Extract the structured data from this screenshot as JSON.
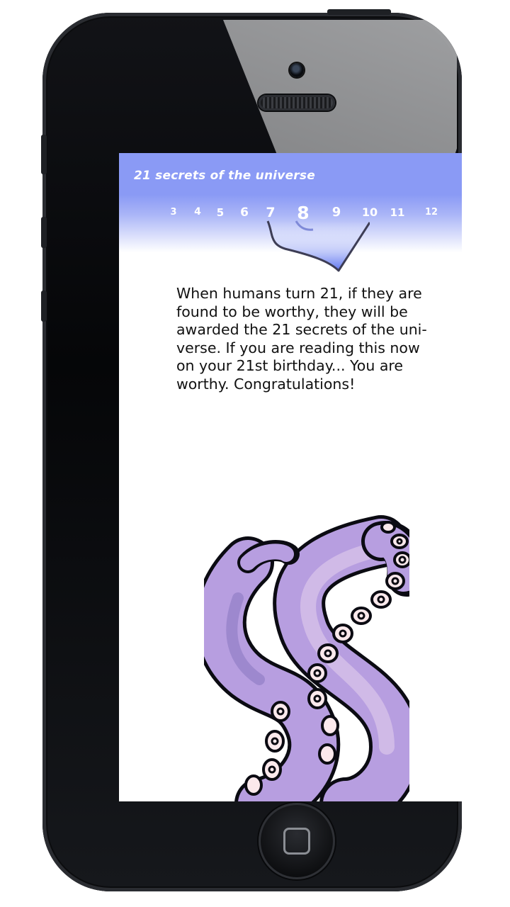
{
  "app": {
    "title": "21 secrets of the universe"
  },
  "pagination": {
    "current": 8,
    "pages": [
      {
        "label": "3",
        "size": 13
      },
      {
        "label": "4",
        "size": 14
      },
      {
        "label": "5",
        "size": 15
      },
      {
        "label": "6",
        "size": 17
      },
      {
        "label": "7",
        "size": 19
      },
      {
        "label": "8",
        "size": 25
      },
      {
        "label": "9",
        "size": 18
      },
      {
        "label": "10",
        "size": 16
      },
      {
        "label": "11",
        "size": 15
      },
      {
        "label": "12",
        "size": 13
      }
    ]
  },
  "content": {
    "lines": [
      "When humans turn 21, if they are",
      "found to be worthy, they will be",
      "awarded the 21 secrets of the uni-",
      "verse. If you are reading this now",
      "on your 21st birthday... You are",
      "worthy. Congratulations!"
    ]
  },
  "colors": {
    "header": "#8a9af5",
    "tentacle_main": "#b79ee0",
    "tentacle_shade": "#9a85cc",
    "sucker": "#fbe9ec"
  },
  "icons": {
    "page_marker": "shield-icon",
    "illustration": "tentacle-number-8-illustration",
    "home": "home-button-icon"
  }
}
